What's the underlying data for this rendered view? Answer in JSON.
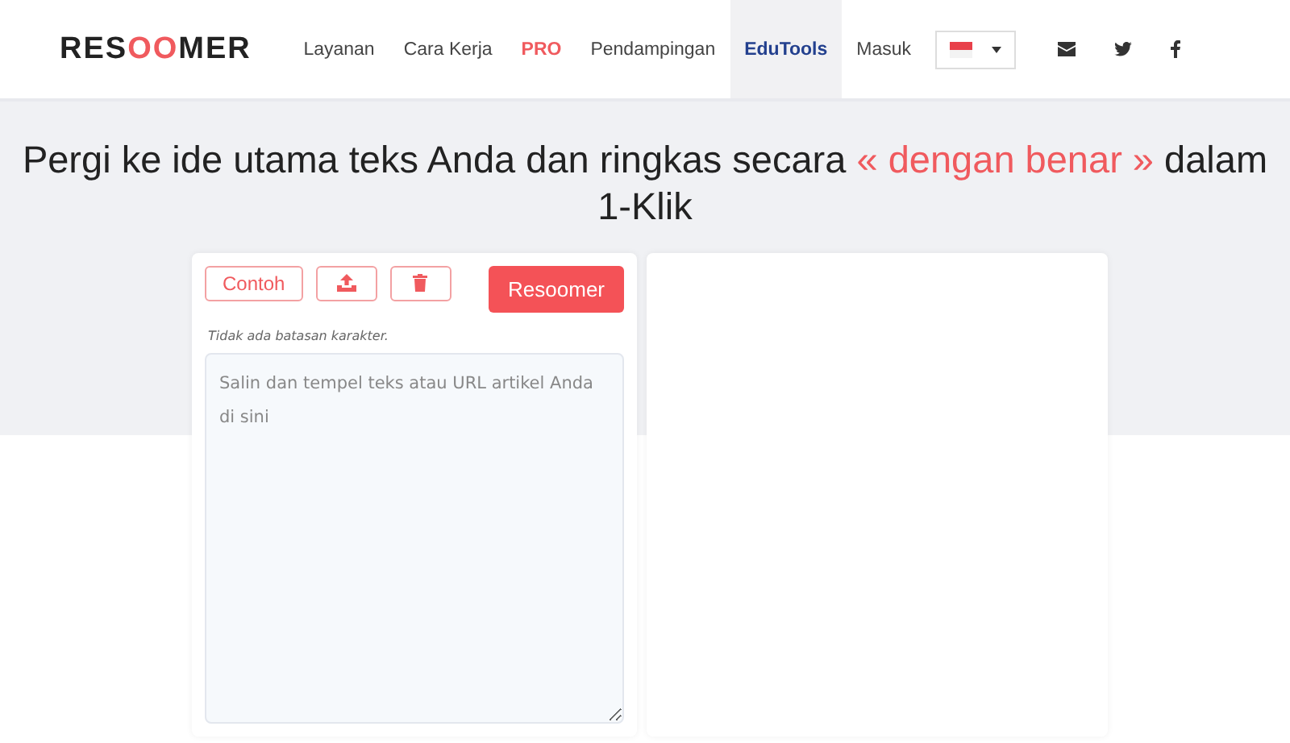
{
  "logo": [
    {
      "text": "RES",
      "accent": false
    },
    {
      "text": "OO",
      "accent": true
    },
    {
      "text": "MER",
      "accent": false
    }
  ],
  "nav": [
    {
      "label": "Layanan",
      "selected": false,
      "highlight": false
    },
    {
      "label": "Cara Kerja",
      "selected": false,
      "highlight": false
    },
    {
      "label": "PRO",
      "selected": false,
      "highlight": true
    },
    {
      "label": "Pendampingan",
      "selected": false,
      "highlight": false
    },
    {
      "label": "EduTools",
      "selected": true,
      "highlight": false
    },
    {
      "label": "Masuk",
      "selected": false,
      "highlight": false
    }
  ],
  "headline": [
    {
      "text": "Pergi ke ide utama teks Anda dan ringkas secara ",
      "accent": false
    },
    {
      "text": "« dengan benar »",
      "accent": true
    },
    {
      "text": " dalam 1-Klik",
      "accent": false
    }
  ],
  "editor": {
    "example_button": "Contoh",
    "submit_button": "Resoomer",
    "note": "Tidak ada batasan karakter.",
    "placeholder": "Salin dan tempel teks atau URL artikel Anda di sini"
  }
}
